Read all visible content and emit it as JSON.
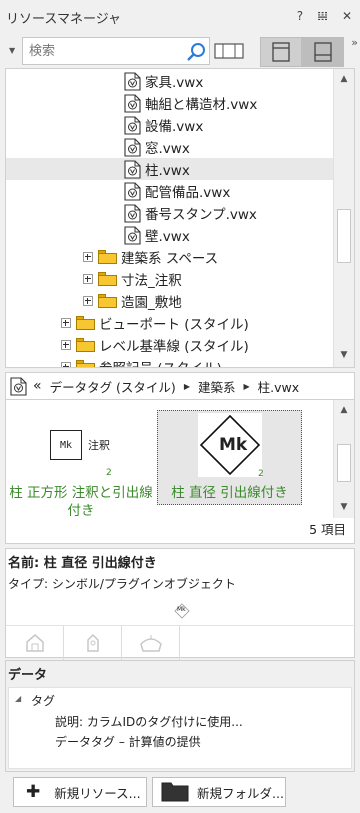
{
  "panel": {
    "title": "リソースマネージャ",
    "help": "?",
    "pin": "𝍐",
    "close": "✕"
  },
  "search": {
    "placeholder": "検索"
  },
  "tree": {
    "files": [
      {
        "label": "家具.vwx"
      },
      {
        "label": "軸組と構造材.vwx"
      },
      {
        "label": "設備.vwx"
      },
      {
        "label": "窓.vwx"
      },
      {
        "label": "柱.vwx",
        "selected": true
      },
      {
        "label": "配管備品.vwx"
      },
      {
        "label": "番号スタンプ.vwx"
      },
      {
        "label": "壁.vwx"
      }
    ],
    "subfolders": [
      {
        "label": "建築系 スペース"
      },
      {
        "label": "寸法_注釈"
      },
      {
        "label": "造園_敷地"
      }
    ],
    "folders": [
      {
        "label": "ビューポート (スタイル)"
      },
      {
        "label": "レベル基準線 (スタイル)"
      },
      {
        "label": "参照記号 (スタイル)"
      }
    ]
  },
  "breadcrumb": {
    "back": "«",
    "parts": [
      "データタグ (スタイル)",
      "建築系",
      "柱.vwx"
    ]
  },
  "thumbnails": {
    "items": [
      {
        "icon_text": "Mk",
        "icon_label": "注釈",
        "badge": "2",
        "caption": "柱 正方形 注釈と引出線付き"
      },
      {
        "icon_text": "Mk",
        "badge": "2",
        "caption": "柱 直径 引出線付き",
        "selected": true
      }
    ],
    "count": "5 項目"
  },
  "info": {
    "name": "名前:  柱 直径 引出線付き",
    "type": "タイプ: シンボル/プラグインオブジェクト",
    "mini_text": "Mk"
  },
  "data_panel": {
    "header": "データ",
    "group": "タグ",
    "lines": [
      "説明: カラムIDのタグ付けに使用...",
      "データタグ – 計算値の提供"
    ]
  },
  "buttons": {
    "new_resource": "新規リソース...",
    "new_folder": "新規フォルダ..."
  },
  "colors": {
    "caption_green": "#3b8a2b",
    "folder_yellow": "#f7c630"
  }
}
